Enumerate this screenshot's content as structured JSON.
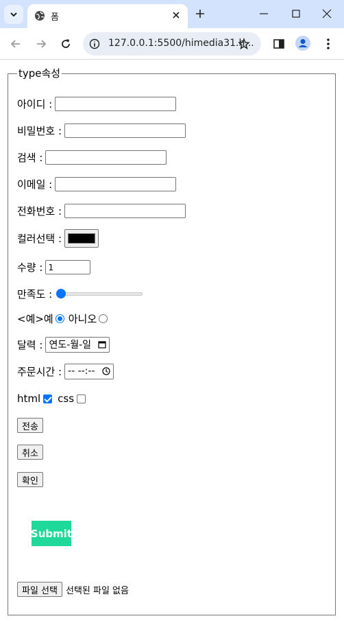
{
  "browser": {
    "tab_title": "폼",
    "url": "127.0.0.1:5500/himedia31.h..."
  },
  "form": {
    "legend": "type속성",
    "id_label": "아이디 :",
    "password_label": "비밀번호 :",
    "search_label": "검색 :",
    "email_label": "이메일 :",
    "phone_label": "전화번호 :",
    "color_label": "컬러선택 :",
    "color_value": "#000000",
    "quantity_label": "수량 :",
    "quantity_value": "1",
    "satisfaction_label": "만족도 :",
    "satisfaction_value": 0,
    "radio_prefix": "<예>예",
    "radio_no": "아니오",
    "calendar_label": "달력 :",
    "date_placeholder": "연도-월-일",
    "time_label": "주문시간 :",
    "time_placeholder": "-- --:--",
    "html_label": "html",
    "css_label": "css",
    "send_button": "전송",
    "cancel_button": "취소",
    "confirm_button": "확인",
    "submit_image_text": "Submit",
    "file_button": "파일 선택",
    "file_status": "선택된 파일 없음"
  }
}
